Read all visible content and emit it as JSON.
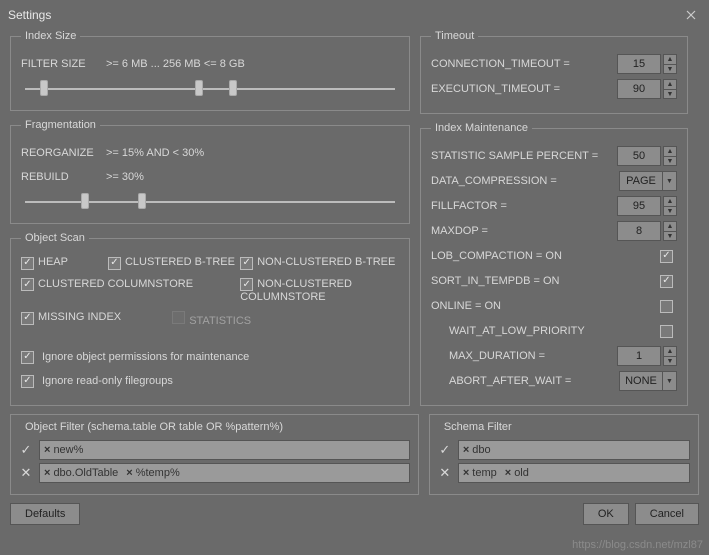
{
  "window": {
    "title": "Settings"
  },
  "indexSize": {
    "legend": "Index Size",
    "filterLabel": "FILTER SIZE",
    "filterValue": ">= 6 MB ... 256 MB <= 8 GB"
  },
  "fragmentation": {
    "legend": "Fragmentation",
    "reorganizeLabel": "REORGANIZE",
    "reorganizeValue": ">= 15% AND < 30%",
    "rebuildLabel": "REBUILD",
    "rebuildValue": ">= 30%"
  },
  "objectScan": {
    "legend": "Object Scan",
    "heap": "HEAP",
    "clusteredBtree": "CLUSTERED B-TREE",
    "nonClusteredBtree": "NON-CLUSTERED B-TREE",
    "clusteredCs": "CLUSTERED COLUMNSTORE",
    "nonClusteredCs": "NON-CLUSTERED COLUMNSTORE",
    "missingIndex": "MISSING INDEX",
    "statistics": "STATISTICS",
    "ignorePerms": "Ignore object permissions for maintenance",
    "ignoreReadonly": "Ignore read-only filegroups"
  },
  "timeout": {
    "legend": "Timeout",
    "conn": "CONNECTION_TIMEOUT =",
    "connVal": "15",
    "exec": "EXECUTION_TIMEOUT =",
    "execVal": "90"
  },
  "maint": {
    "legend": "Index Maintenance",
    "statPct": "STATISTIC SAMPLE PERCENT =",
    "statPctVal": "50",
    "dataComp": "DATA_COMPRESSION =",
    "dataCompVal": "PAGE",
    "fillFactor": "FILLFACTOR =",
    "fillFactorVal": "95",
    "maxdop": "MAXDOP =",
    "maxdopVal": "8",
    "lobComp": "LOB_COMPACTION = ON",
    "sortTemp": "SORT_IN_TEMPDB = ON",
    "online": "ONLINE = ON",
    "waitLow": "WAIT_AT_LOW_PRIORITY",
    "maxDur": "MAX_DURATION =",
    "maxDurVal": "1",
    "abortWait": "ABORT_AFTER_WAIT =",
    "abortWaitVal": "NONE"
  },
  "objectFilter": {
    "legend": "Object Filter (schema.table OR table OR %pattern%)",
    "include": [
      "new%"
    ],
    "exclude": [
      "dbo.OldTable",
      "%temp%"
    ]
  },
  "schemaFilter": {
    "legend": "Schema Filter",
    "include": [
      "dbo"
    ],
    "exclude": [
      "temp",
      "old"
    ]
  },
  "footer": {
    "defaults": "Defaults",
    "ok": "OK",
    "cancel": "Cancel"
  },
  "watermark": "https://blog.csdn.net/mzl87"
}
